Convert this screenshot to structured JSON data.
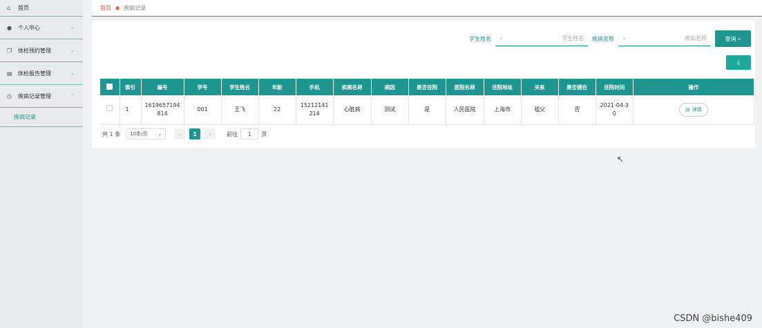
{
  "sidebar": {
    "items": [
      {
        "label": "首页",
        "icon": "home-icon",
        "glyph": "⌂",
        "chevron": ""
      },
      {
        "label": "个人中心",
        "icon": "user-icon",
        "glyph": "●",
        "chevron": "⌄"
      },
      {
        "label": "体检预约管理",
        "icon": "copy-icon",
        "glyph": "❐",
        "chevron": "⌄"
      },
      {
        "label": "体检报告管理",
        "icon": "report-icon",
        "glyph": "▤",
        "chevron": "⌄"
      },
      {
        "label": "疾病记录管理",
        "icon": "clock-icon",
        "glyph": "◷",
        "chevron": "⌃"
      }
    ],
    "sub_item": "疾病记录"
  },
  "breadcrumb": {
    "home": "首页",
    "current": "疾病记录"
  },
  "search": {
    "student_label": "学生姓名",
    "student_placeholder": "学生姓名",
    "disease_label": "疾病名称",
    "disease_placeholder": "疾病名称",
    "query_button": "查询 ⌕"
  },
  "download_button": "⤓",
  "table": {
    "headers": [
      "索引",
      "编号",
      "学号",
      "学生姓名",
      "年龄",
      "手机",
      "疾病名称",
      "病因",
      "是否住院",
      "医院名称",
      "住院地址",
      "关系",
      "是否健在",
      "住院时间",
      "操作"
    ],
    "rows": [
      {
        "index": "1",
        "code_l1": "1619657194",
        "code_l2": "814",
        "student_no": "001",
        "name": "王飞",
        "age": "22",
        "phone_l1": "15212141",
        "phone_l2": "214",
        "disease": "心脏病",
        "cause": "测试",
        "hospitalized": "是",
        "hospital": "人民医院",
        "address": "上海市",
        "relation": "祖父",
        "alive": "否",
        "date_l1": "2021-04-3",
        "date_l2": "0",
        "action": "详情"
      }
    ]
  },
  "pagination": {
    "total": "共 1 条",
    "page_size": "10条/页",
    "current_page": "1",
    "goto_label": "前往",
    "goto_value": "1",
    "page_suffix": "页"
  },
  "watermark": "CSDN @bishe409",
  "colors": {
    "primary": "#1e9591",
    "breadcrumb_home": "#e0623c"
  }
}
